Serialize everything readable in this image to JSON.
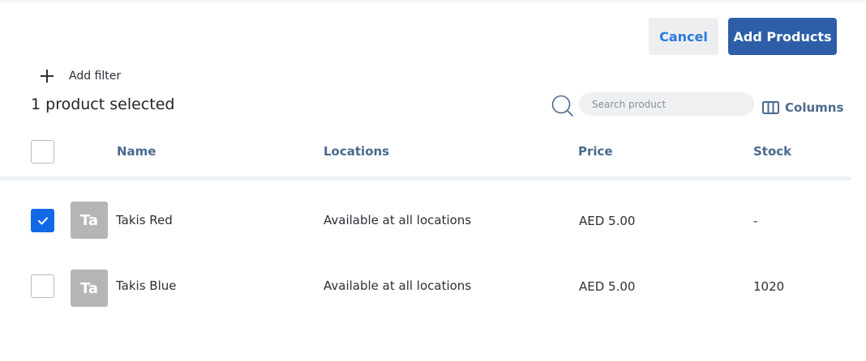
{
  "actions": {
    "cancel_label": "Cancel",
    "add_products_label": "Add Products"
  },
  "filter": {
    "add_filter_label": "Add filter"
  },
  "selection": {
    "count_text": "1 product selected"
  },
  "search": {
    "placeholder": "Search product",
    "value": ""
  },
  "columns_label": "Columns",
  "table": {
    "columns": [
      "Name",
      "Locations",
      "Price",
      "Stock"
    ],
    "rows": [
      {
        "checked": true,
        "thumb": "Ta",
        "name": "Takis Red",
        "locations": "Available at all locations",
        "price": "AED 5.00",
        "stock": "-"
      },
      {
        "checked": false,
        "thumb": "Ta",
        "name": "Takis Blue",
        "locations": "Available at all locations",
        "price": "AED 5.00",
        "stock": "1020"
      }
    ]
  },
  "colors": {
    "primary": "#2d5ea7",
    "link": "#2a7ad8",
    "checkbox_checked": "#1269e8",
    "header_text": "#4b6a8f",
    "thumbnail": "#b5b5b5"
  },
  "icons": [
    "plus-icon",
    "search-icon",
    "columns-icon",
    "checkmark-icon"
  ]
}
